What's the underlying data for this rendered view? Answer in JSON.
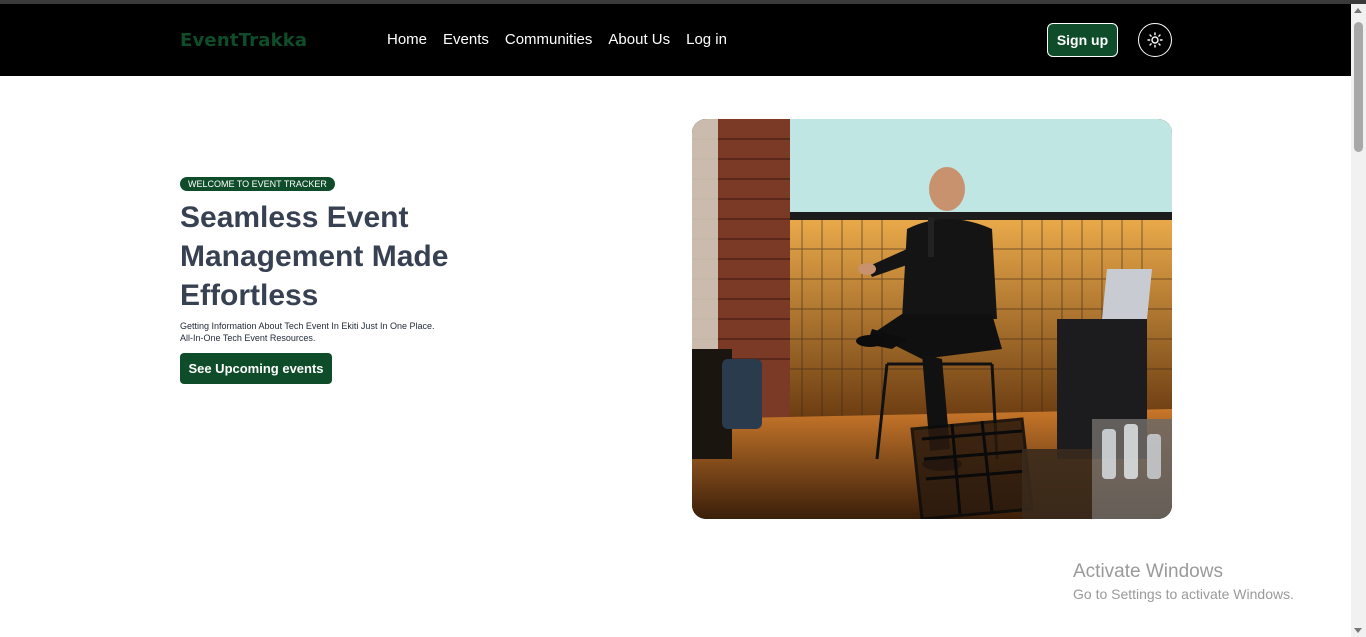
{
  "header": {
    "logo": "EventTrakka",
    "nav": [
      "Home",
      "Events",
      "Communities",
      "About Us",
      "Log in"
    ],
    "signup_label": "Sign up",
    "theme_icon": "sun-icon"
  },
  "hero": {
    "badge": "WELCOME TO EVENT TRACKER",
    "headline": "Seamless Event Management Made Effortless",
    "subtext": "Getting Information About Tech Event In Ekiti Just In One Place. All-In-One Tech Event Resources.",
    "cta_label": "See Upcoming events",
    "image_subject": "speaker-on-stage-photo"
  },
  "watermark": {
    "title": "Activate Windows",
    "subtitle": "Go to Settings to activate Windows."
  },
  "colors": {
    "brand_green": "#0f4d2a",
    "navbar_bg": "#000000",
    "heading_text": "#374151"
  }
}
